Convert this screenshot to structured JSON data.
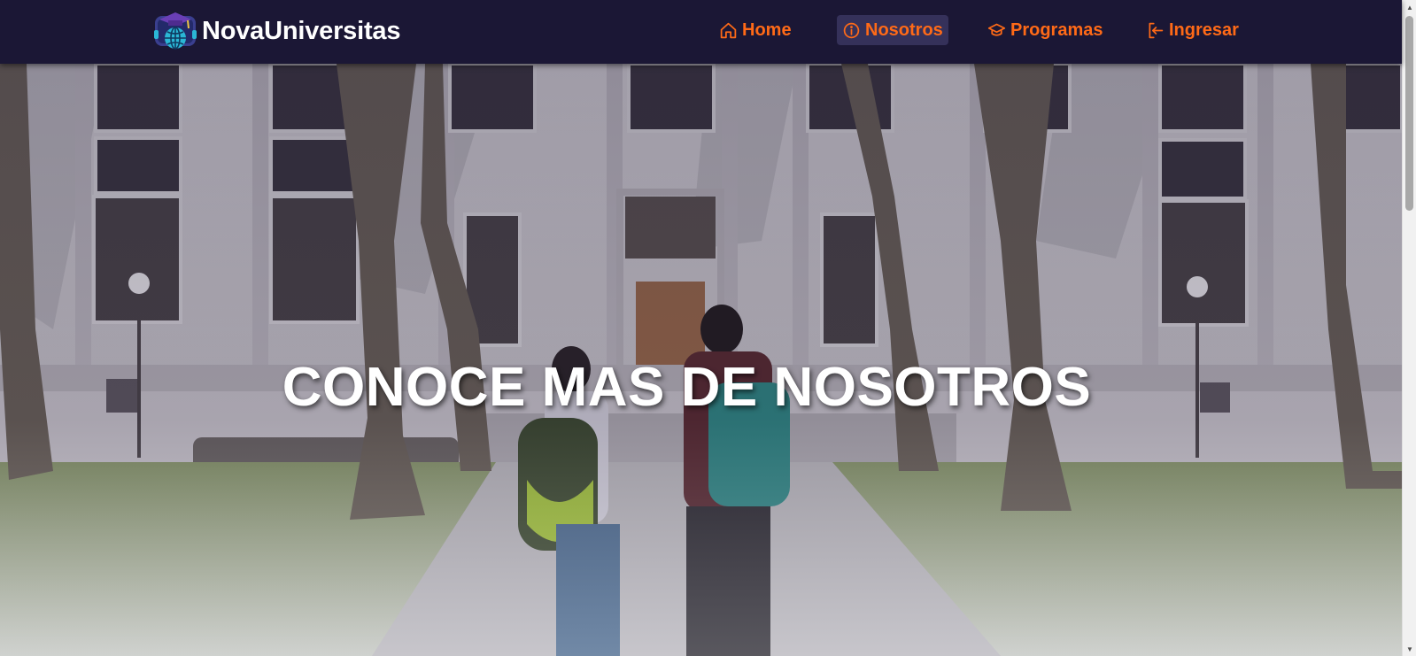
{
  "brand": {
    "name": "NovaUniversitas",
    "logo_icon": "globe-graduation-cap-icon"
  },
  "nav": {
    "items": [
      {
        "label": "Home",
        "icon": "home-icon",
        "active": false
      },
      {
        "label": "Nosotros",
        "icon": "info-circle-icon",
        "active": true
      },
      {
        "label": "Programas",
        "icon": "graduation-cap-icon",
        "active": false
      },
      {
        "label": "Ingresar",
        "icon": "login-icon",
        "active": false
      }
    ]
  },
  "hero": {
    "title": "CONOCE MAS DE NOSOTROS",
    "image": "campus-building-students-photo"
  },
  "colors": {
    "navbar_bg": "#1b1735",
    "nav_accent": "#ff6a17",
    "active_bg": "#35315a",
    "hero_text": "#ffffff"
  }
}
